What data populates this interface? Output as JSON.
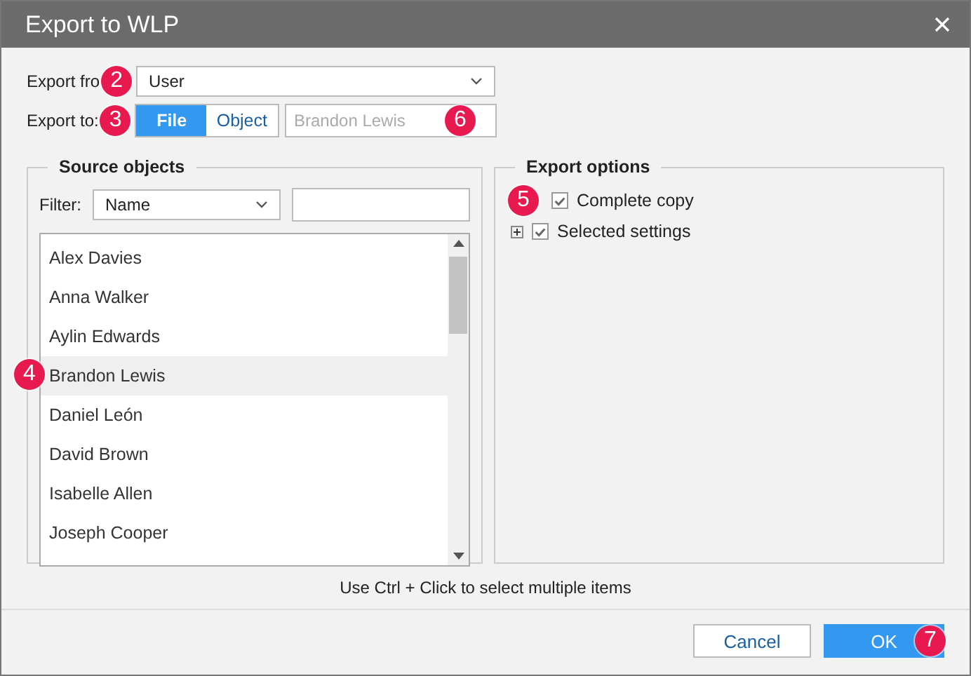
{
  "window": {
    "title": "Export to WLP"
  },
  "export_from": {
    "label": "Export fro",
    "value": "User"
  },
  "export_to": {
    "label": "Export to:",
    "options": [
      {
        "label": "File",
        "selected": true
      },
      {
        "label": "Object",
        "selected": false
      }
    ],
    "target": {
      "placeholder": "Brandon Lewis"
    }
  },
  "source_objects": {
    "title": "Source objects",
    "filter_label": "Filter:",
    "filter_value": "Name",
    "items": [
      {
        "label": "Alex Davies",
        "selected": false
      },
      {
        "label": "Anna Walker",
        "selected": false
      },
      {
        "label": "Aylin Edwards",
        "selected": false
      },
      {
        "label": "Brandon Lewis",
        "selected": true
      },
      {
        "label": "Daniel León",
        "selected": false
      },
      {
        "label": "David Brown",
        "selected": false
      },
      {
        "label": "Isabelle Allen",
        "selected": false
      },
      {
        "label": "Joseph Cooper",
        "selected": false
      }
    ]
  },
  "export_options": {
    "title": "Export options",
    "items": [
      {
        "label": "Complete copy",
        "checked": true
      },
      {
        "label": "Selected settings",
        "checked": true,
        "expanded": false
      }
    ]
  },
  "hint": "Use Ctrl + Click to select multiple items",
  "buttons": [
    {
      "label": "Cancel",
      "kind": "secondary"
    },
    {
      "label": "OK",
      "kind": "primary"
    }
  ],
  "callouts": [
    "2",
    "3",
    "4",
    "5",
    "6",
    "7"
  ]
}
